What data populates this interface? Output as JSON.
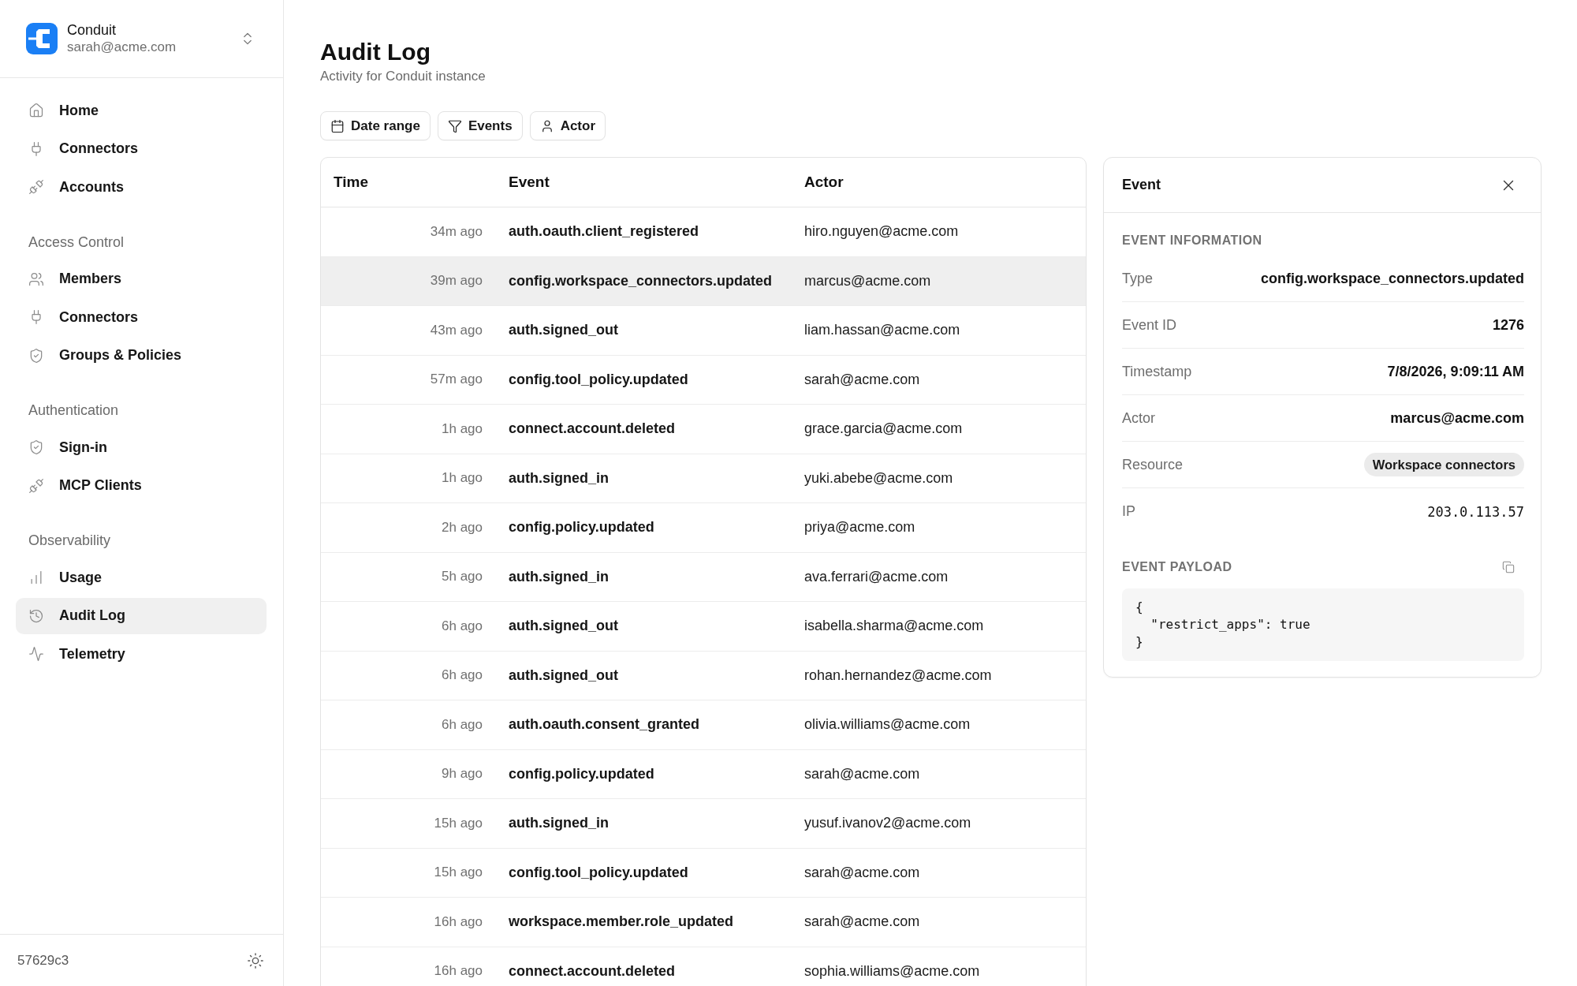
{
  "workspace": {
    "name": "Conduit",
    "email": "sarah@acme.com"
  },
  "sidebar": {
    "groups": [
      {
        "items": [
          {
            "label": "Home",
            "selected": false
          },
          {
            "label": "Connectors",
            "selected": false
          },
          {
            "label": "Accounts",
            "selected": false
          }
        ]
      },
      {
        "title": "Access Control",
        "items": [
          {
            "label": "Members",
            "selected": false
          },
          {
            "label": "Connectors",
            "selected": false
          },
          {
            "label": "Groups & Policies",
            "selected": false
          }
        ]
      },
      {
        "title": "Authentication",
        "items": [
          {
            "label": "Sign-in",
            "selected": false
          },
          {
            "label": "MCP Clients",
            "selected": false
          }
        ]
      },
      {
        "title": "Observability",
        "items": [
          {
            "label": "Usage",
            "selected": false
          },
          {
            "label": "Audit Log",
            "selected": true
          },
          {
            "label": "Telemetry",
            "selected": false
          }
        ]
      }
    ],
    "footer": {
      "version": "57629c3"
    }
  },
  "page": {
    "title": "Audit Log",
    "subtitle": "Activity for Conduit instance"
  },
  "filters": [
    {
      "label": "Date range"
    },
    {
      "label": "Events"
    },
    {
      "label": "Actor"
    }
  ],
  "table": {
    "columns": [
      "Time",
      "Event",
      "Actor"
    ],
    "rows": [
      {
        "time": "34m ago",
        "event": "auth.oauth.client_registered",
        "actor": "hiro.nguyen@acme.com",
        "selected": false
      },
      {
        "time": "39m ago",
        "event": "config.workspace_connectors.updated",
        "actor": "marcus@acme.com",
        "selected": true
      },
      {
        "time": "43m ago",
        "event": "auth.signed_out",
        "actor": "liam.hassan@acme.com",
        "selected": false
      },
      {
        "time": "57m ago",
        "event": "config.tool_policy.updated",
        "actor": "sarah@acme.com",
        "selected": false
      },
      {
        "time": "1h ago",
        "event": "connect.account.deleted",
        "actor": "grace.garcia@acme.com",
        "selected": false
      },
      {
        "time": "1h ago",
        "event": "auth.signed_in",
        "actor": "yuki.abebe@acme.com",
        "selected": false
      },
      {
        "time": "2h ago",
        "event": "config.policy.updated",
        "actor": "priya@acme.com",
        "selected": false
      },
      {
        "time": "5h ago",
        "event": "auth.signed_in",
        "actor": "ava.ferrari@acme.com",
        "selected": false
      },
      {
        "time": "6h ago",
        "event": "auth.signed_out",
        "actor": "isabella.sharma@acme.com",
        "selected": false
      },
      {
        "time": "6h ago",
        "event": "auth.signed_out",
        "actor": "rohan.hernandez@acme.com",
        "selected": false
      },
      {
        "time": "6h ago",
        "event": "auth.oauth.consent_granted",
        "actor": "olivia.williams@acme.com",
        "selected": false
      },
      {
        "time": "9h ago",
        "event": "config.policy.updated",
        "actor": "sarah@acme.com",
        "selected": false
      },
      {
        "time": "15h ago",
        "event": "auth.signed_in",
        "actor": "yusuf.ivanov2@acme.com",
        "selected": false
      },
      {
        "time": "15h ago",
        "event": "config.tool_policy.updated",
        "actor": "sarah@acme.com",
        "selected": false
      },
      {
        "time": "16h ago",
        "event": "workspace.member.role_updated",
        "actor": "sarah@acme.com",
        "selected": false
      },
      {
        "time": "16h ago",
        "event": "connect.account.deleted",
        "actor": "sophia.williams@acme.com",
        "selected": false
      }
    ]
  },
  "event_panel": {
    "title": "Event",
    "section_title": "EVENT INFORMATION",
    "fields": [
      {
        "label": "Type",
        "value": "config.workspace_connectors.updated",
        "kind": "text"
      },
      {
        "label": "Event ID",
        "value": "1276",
        "kind": "text"
      },
      {
        "label": "Timestamp",
        "value": "7/8/2026, 9:09:11 AM",
        "kind": "text"
      },
      {
        "label": "Actor",
        "value": "marcus@acme.com",
        "kind": "text"
      },
      {
        "label": "Resource",
        "value": "Workspace connectors",
        "kind": "tag"
      },
      {
        "label": "IP",
        "value": "203.0.113.57",
        "kind": "mono"
      }
    ],
    "payload": {
      "title": "EVENT PAYLOAD",
      "code": "{\n  \"restrict_apps\": true\n}"
    }
  }
}
